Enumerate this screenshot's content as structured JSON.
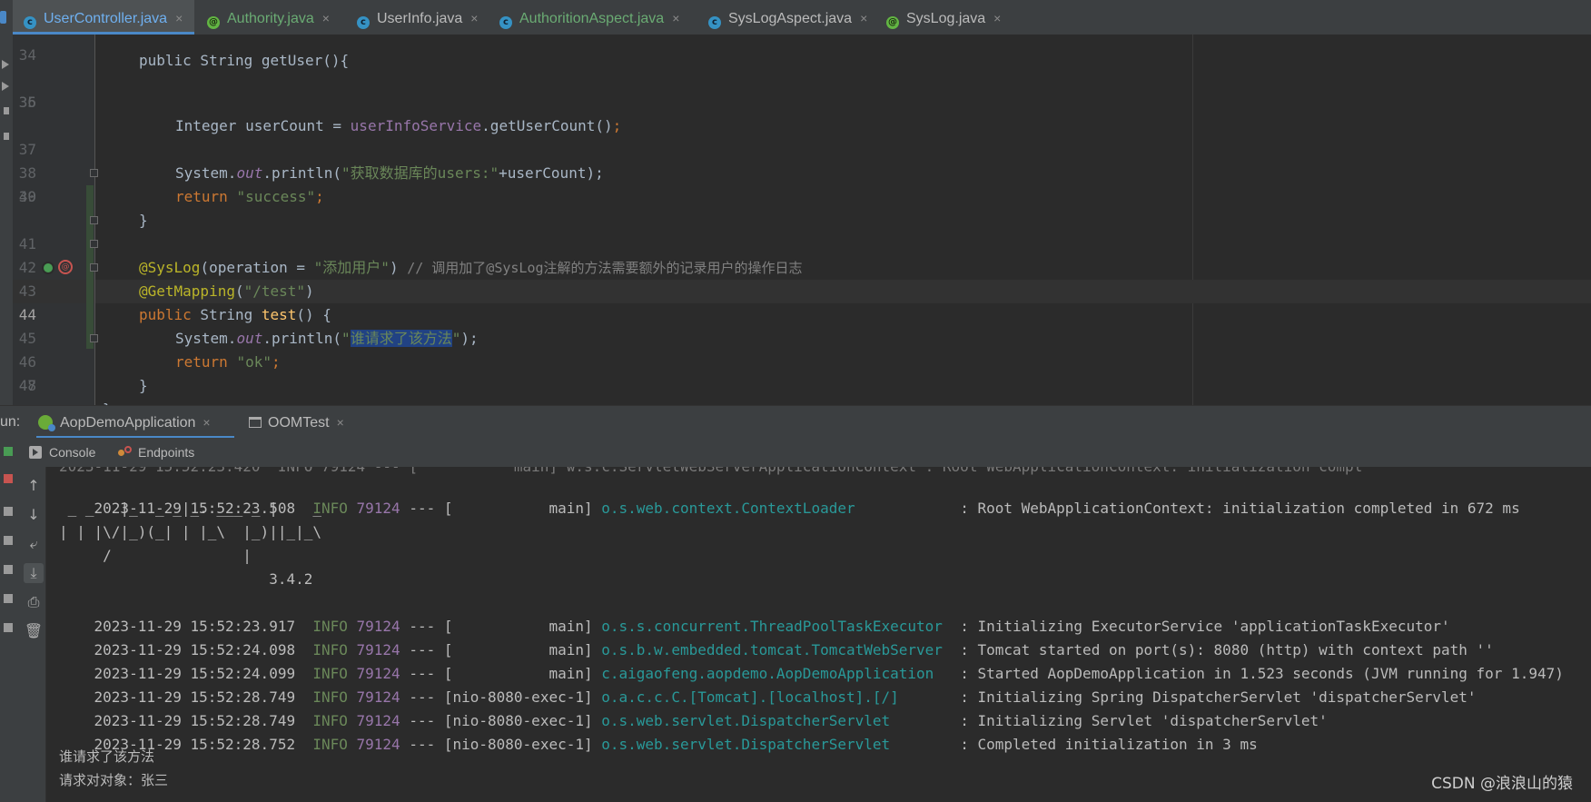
{
  "tabs": [
    {
      "label": "UserController.java",
      "icon": "class-icon",
      "active": true,
      "color": "#6fb0f0"
    },
    {
      "label": "Authority.java",
      "icon": "annotation-icon",
      "active": false,
      "color": "#6aab73"
    },
    {
      "label": "UserInfo.java",
      "icon": "class-icon",
      "active": false,
      "color": "#6fb0f0"
    },
    {
      "label": "AuthoritionAspect.java",
      "icon": "class-icon",
      "active": false,
      "color": "#6aab73"
    },
    {
      "label": "SysLogAspect.java",
      "icon": "class-icon",
      "active": false,
      "color": "#6fb0f0"
    },
    {
      "label": "SysLog.java",
      "icon": "annotation-icon",
      "active": false,
      "color": "#6fb0f0"
    }
  ],
  "tab_close": "×",
  "editor": {
    "top_partial": "public String getUser(){",
    "line_numbers": [
      "34",
      "35",
      "36",
      "37",
      "38",
      "39",
      "40",
      "41",
      "42",
      "43",
      "44",
      "45",
      "46",
      "47",
      "48"
    ],
    "current_line": "44",
    "tokens": {
      "l35_type": "Integer",
      "l35_var": " userCount = ",
      "l35_svc": "userInfoService",
      "l35_call": ".getUserCount()",
      "l35_semi": ";",
      "l37_sys": "System.",
      "l37_out": "out",
      "l37_print": ".println(",
      "l37_str": "\"获取数据库的users:\"",
      "l37_rest": "+userCount);",
      "l38_kw": "return",
      "l38_str": "\"success\"",
      "l38_semi": ";",
      "l39_brace": "}",
      "l41_ann": "@SysLog",
      "l41_open": "(operation = ",
      "l41_str": "\"添加用户\"",
      "l41_close": ") ",
      "l41_cmt": "// 调用加了@SysLog注解的方法需要额外的记录用户的操作日志",
      "l42_ann": "@GetMapping",
      "l42_open": "(",
      "l42_str": "\"/test\"",
      "l42_close": ")",
      "l43_kw": "public",
      "l43_type": " String ",
      "l43_fn": "test",
      "l43_rest": "() {",
      "l44_sys": "System.",
      "l44_out": "out",
      "l44_print": ".println(",
      "l44_q1": "\"",
      "l44_sel": "谁请求了该方法",
      "l44_q2": "\"",
      "l44_rest": ");",
      "l45_kw": "return",
      "l45_str": "\"ok\"",
      "l45_semi": ";",
      "l46_brace": "}",
      "l47_brace": "}"
    }
  },
  "run_panel": {
    "label": "un:",
    "tabs": [
      {
        "label": "AopDemoApplication",
        "icon": "spring-boot-icon",
        "active": true
      },
      {
        "label": "OOMTest",
        "icon": "window-icon",
        "active": false
      }
    ],
    "subtabs": [
      {
        "label": "Console",
        "icon": "console-icon"
      },
      {
        "label": "Endpoints",
        "icon": "endpoints-icon"
      }
    ],
    "tools": [
      "arrow-up-icon",
      "arrow-down-icon",
      "soft-wrap-icon",
      "scroll-to-end-icon",
      "print-icon",
      "trash-icon"
    ]
  },
  "console": {
    "log1": {
      "ts": "2023-11-29 15:52:23.508 ",
      "lvl": " INFO ",
      "pid": "79124",
      "mid": " --- [           main] ",
      "logger": "o.s.web.context.ContextLoader           ",
      "msg": " : Root WebApplicationContext: initialization completed in 672 ms"
    },
    "banner": [
      " _ _   |_  _ _|_. ___ _ |    _",
      "| | |\\/|_)(_| | |_\\  |_)||_|_\\",
      "     /               |",
      "                        3.4.2"
    ],
    "logs": [
      {
        "ts": "2023-11-29 15:52:23.917 ",
        "lvl": " INFO ",
        "pid": "79124",
        "mid": " --- [           main] ",
        "logger": "o.s.s.concurrent.ThreadPoolTaskExecutor ",
        "msg": " : Initializing ExecutorService 'applicationTaskExecutor'"
      },
      {
        "ts": "2023-11-29 15:52:24.098 ",
        "lvl": " INFO ",
        "pid": "79124",
        "mid": " --- [           main] ",
        "logger": "o.s.b.w.embedded.tomcat.TomcatWebServer ",
        "msg": " : Tomcat started on port(s): 8080 (http) with context path ''"
      },
      {
        "ts": "2023-11-29 15:52:24.099 ",
        "lvl": " INFO ",
        "pid": "79124",
        "mid": " --- [           main] ",
        "logger": "c.aigaofeng.aopdemo.AopDemoApplication  ",
        "msg": " : Started AopDemoApplication in 1.523 seconds (JVM running for 1.947)"
      },
      {
        "ts": "2023-11-29 15:52:28.749 ",
        "lvl": " INFO ",
        "pid": "79124",
        "mid": " --- [nio-8080-exec-1] ",
        "logger": "o.a.c.c.C.[Tomcat].[localhost].[/]      ",
        "msg": " : Initializing Spring DispatcherServlet 'dispatcherServlet'"
      },
      {
        "ts": "2023-11-29 15:52:28.749 ",
        "lvl": " INFO ",
        "pid": "79124",
        "mid": " --- [nio-8080-exec-1] ",
        "logger": "o.s.web.servlet.DispatcherServlet       ",
        "msg": " : Initializing Servlet 'dispatcherServlet'"
      },
      {
        "ts": "2023-11-29 15:52:28.752 ",
        "lvl": " INFO ",
        "pid": "79124",
        "mid": " --- [nio-8080-exec-1] ",
        "logger": "o.s.web.servlet.DispatcherServlet       ",
        "msg": " : Completed initialization in 3 ms"
      }
    ],
    "output": [
      "谁请求了该方法",
      "请求对对象：张三"
    ]
  },
  "watermark": "CSDN @浪浪山的猿",
  "colors": {
    "accent": "#4a88c7",
    "keyword": "#cc7832",
    "string": "#6a8759",
    "annotation": "#bbb529",
    "field": "#9876aa",
    "logger": "#299999"
  }
}
